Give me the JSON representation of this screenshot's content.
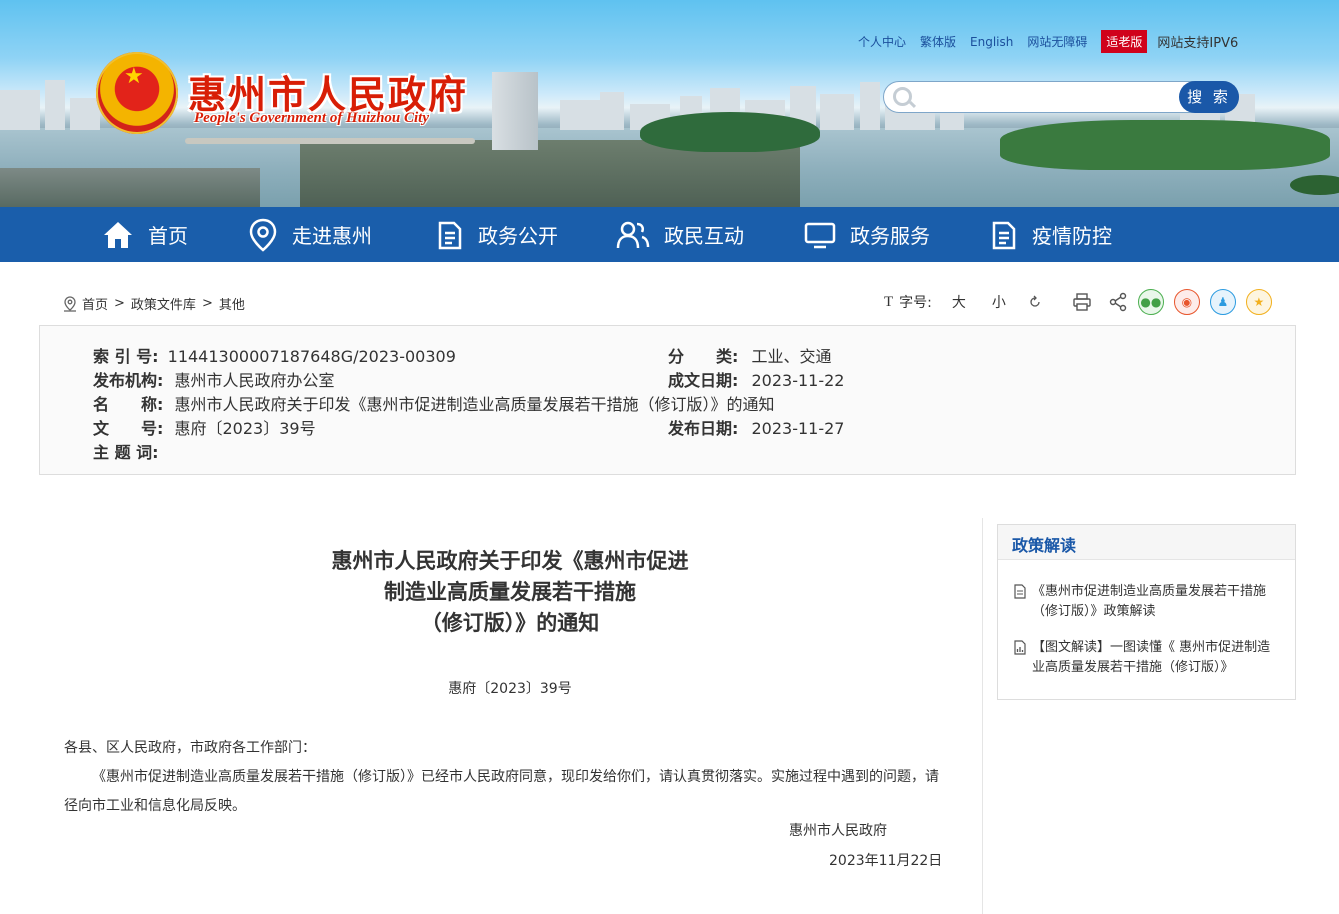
{
  "header": {
    "title_cn": "惠州市人民政府",
    "title_en": "People's Government of Huizhou City",
    "top_links": [
      "个人中心",
      "繁体版",
      "English",
      "网站无障碍"
    ],
    "elder_mode": "适老版",
    "ipv6": "网站支持IPV6",
    "search": {
      "placeholder": "",
      "button": "搜 索"
    }
  },
  "nav": {
    "items": [
      "首页",
      "走进惠州",
      "政务公开",
      "政民互动",
      "政务服务",
      "疫情防控"
    ]
  },
  "breadcrumb": [
    "首页",
    "政策文件库",
    "其他"
  ],
  "toolbar": {
    "font_label": "字号:",
    "font_large": "大",
    "font_small": "小"
  },
  "info": {
    "index_label": "索 引 号:",
    "index_value": "11441300007187648G/2023-00309",
    "category_label": "分　　类:",
    "category_value": "工业、交通",
    "publisher_label": "发布机构:",
    "publisher_value": "惠州市人民政府办公室",
    "created_label": "成文日期:",
    "created_value": "2023-11-22",
    "name_label": "名　　称:",
    "name_value": "惠州市人民政府关于印发《惠州市促进制造业高质量发展若干措施（修订版）》的通知",
    "docno_label": "文　　号:",
    "docno_value": "惠府〔2023〕39号",
    "published_label": "发布日期:",
    "published_value": "2023-11-27",
    "topic_label": "主 题 词:",
    "topic_value": ""
  },
  "article": {
    "title_lines": [
      "惠州市人民政府关于印发《惠州市促进",
      "制造业高质量发展若干措施",
      "（修订版）》的通知"
    ],
    "doc_number": "惠府〔2023〕39号",
    "salutation": "各县、区人民政府，市政府各工作部门：",
    "paragraph": "《惠州市促进制造业高质量发展若干措施（修订版）》已经市人民政府同意，现印发给你们，请认真贯彻落实。实施过程中遇到的问题，请径向市工业和信息化局反映。",
    "signature": "惠州市人民政府",
    "date": "2023年11月22日"
  },
  "side_panel": {
    "title": "政策解读",
    "links": [
      "《惠州市促进制造业高质量发展若干措施（修订版）》政策解读",
      "【图文解读】一图读懂《 惠州市促进制造业高质量发展若干措施（修订版）》"
    ]
  },
  "colors": {
    "nav_bg": "#1a5eab",
    "title_red": "#d81e06",
    "link_blue": "#1a58a8",
    "elder_red": "#d0021b"
  }
}
